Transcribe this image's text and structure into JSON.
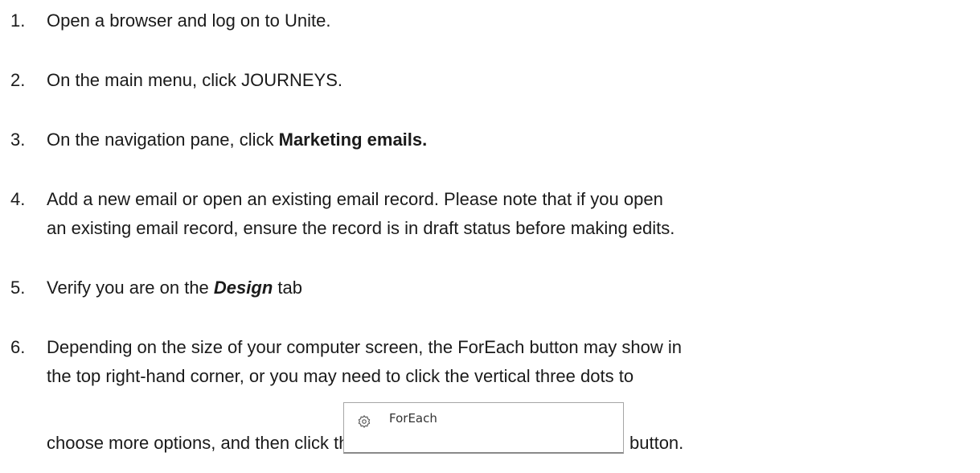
{
  "steps": [
    {
      "number": "1.",
      "lines": [
        [
          "Open a browser and log on to Unite."
        ]
      ]
    },
    {
      "number": "2.",
      "lines": [
        [
          "On the main menu, click JOURNEYS."
        ]
      ]
    },
    {
      "number": "3.",
      "prefix": "On the navigation pane, click ",
      "bold": "Marketing emails."
    },
    {
      "number": "4.",
      "line1": "Add a new email or open an existing email record. Please note that if you open",
      "line2": "an existing email record, ensure the record is in draft status before making edits."
    },
    {
      "number": "5.",
      "prefix": "Verify you are on the ",
      "bolditalic": "Design",
      "suffix": " tab"
    },
    {
      "number": "6.",
      "line1": "Depending on the size of your computer screen, the ForEach button may show in",
      "line2": "the top right-hand corner, or you may need to click the vertical three dots to",
      "line3_prefix": "choose more options, and then click the",
      "line3_suffix": "button."
    }
  ],
  "foreach_button": {
    "label": "ForEach",
    "icon": "gear-icon"
  }
}
